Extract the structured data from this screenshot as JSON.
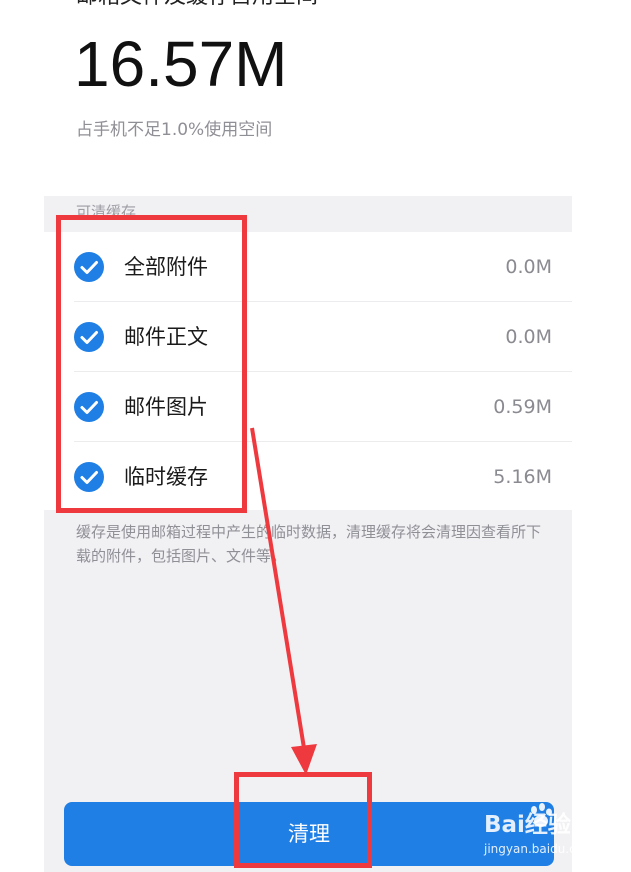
{
  "summary": {
    "top_partial_text": "邮箱文件及缓存占用空间",
    "size_value": "16.57M",
    "usage_note": "占手机不足1.0%使用空间"
  },
  "section_label": "可清缓存",
  "items": [
    {
      "label": "全部附件",
      "size": "0.0M",
      "checked": true
    },
    {
      "label": "邮件正文",
      "size": "0.0M",
      "checked": true
    },
    {
      "label": "邮件图片",
      "size": "0.59M",
      "checked": true
    },
    {
      "label": "临时缓存",
      "size": "5.16M",
      "checked": true
    }
  ],
  "description": "缓存是使用邮箱过程中产生的临时数据，清理缓存将会清理因查看所下载的附件，包括图片、文件等。",
  "clean_button_label": "清理",
  "watermark": {
    "main": "Bai经验",
    "sub": "jingyan.baidu.com"
  },
  "colors": {
    "accent": "#1f7fe5",
    "annotation": "#ee3a3f",
    "background": "#f1f1f4"
  }
}
